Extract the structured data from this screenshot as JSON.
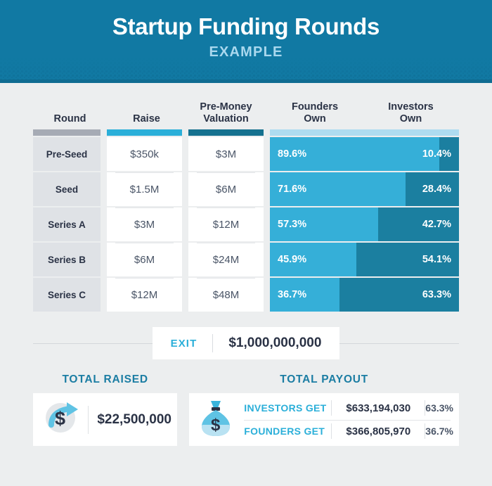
{
  "header": {
    "title": "Startup Funding Rounds",
    "subtitle": "EXAMPLE",
    "bg_color": "#1179A3",
    "title_color": "#FFFFFF",
    "subtitle_color": "#A9D8EE"
  },
  "table": {
    "columns": [
      {
        "key": "round",
        "label": "Round",
        "accent_color": "#A6ABB5"
      },
      {
        "key": "raise",
        "label": "Raise",
        "accent_color": "#2BAFD9"
      },
      {
        "key": "premoney",
        "label": "Pre-Money\nValuation",
        "label_line1": "Pre-Money",
        "label_line2": "Valuation",
        "accent_color": "#15718F"
      },
      {
        "key": "founders",
        "label_line1": "Founders",
        "label_line2": "Own",
        "accent_color": "#AEDCF0"
      },
      {
        "key": "investors",
        "label_line1": "Investors",
        "label_line2": "Own",
        "accent_color": "#AEDCF0"
      }
    ],
    "rows": [
      {
        "round": "Pre-Seed",
        "raise": "$350k",
        "premoney": "$3M",
        "founders_pct": "89.6%",
        "investors_pct": "10.4%",
        "founders_value": 89.6,
        "investors_value": 10.4
      },
      {
        "round": "Seed",
        "raise": "$1.5M",
        "premoney": "$6M",
        "founders_pct": "71.6%",
        "investors_pct": "28.4%",
        "founders_value": 71.6,
        "investors_value": 28.4
      },
      {
        "round": "Series A",
        "raise": "$3M",
        "premoney": "$12M",
        "founders_pct": "57.3%",
        "investors_pct": "42.7%",
        "founders_value": 57.3,
        "investors_value": 42.7
      },
      {
        "round": "Series B",
        "raise": "$6M",
        "premoney": "$24M",
        "founders_pct": "45.9%",
        "investors_pct": "54.1%",
        "founders_value": 45.9,
        "investors_value": 54.1
      },
      {
        "round": "Series C",
        "raise": "$12M",
        "premoney": "$48M",
        "founders_pct": "36.7%",
        "investors_pct": "63.3%",
        "founders_value": 36.7,
        "investors_value": 63.3
      }
    ],
    "founders_bar_color": "#35AFD8",
    "investors_bar_color": "#1B7FA0"
  },
  "exit": {
    "label": "EXIT",
    "value": "$1,000,000,000",
    "label_color": "#2BAFD9"
  },
  "total_raised": {
    "title": "TOTAL RAISED",
    "value": "$22,500,000",
    "icon": "dollar-arrow-up-icon"
  },
  "total_payout": {
    "title": "TOTAL PAYOUT",
    "icon": "money-bag-icon",
    "rows": [
      {
        "label": "INVESTORS GET",
        "amount": "$633,194,030",
        "pct": "63.3%"
      },
      {
        "label": "FOUNDERS GET",
        "amount": "$366,805,970",
        "pct": "36.7%"
      }
    ]
  },
  "chart_data": {
    "type": "bar",
    "title": "Startup Funding Rounds",
    "subtitle": "EXAMPLE",
    "orientation": "horizontal-stacked",
    "categories": [
      "Pre-Seed",
      "Seed",
      "Series A",
      "Series B",
      "Series C"
    ],
    "series": [
      {
        "name": "Founders Own",
        "values": [
          89.6,
          71.6,
          57.3,
          45.9,
          36.7
        ],
        "color": "#35AFD8",
        "unit": "%"
      },
      {
        "name": "Investors Own",
        "values": [
          10.4,
          28.4,
          42.7,
          54.1,
          63.3
        ],
        "color": "#1B7FA0",
        "unit": "%"
      }
    ],
    "table_columns": [
      "Round",
      "Raise",
      "Pre-Money Valuation",
      "Founders Own",
      "Investors Own"
    ],
    "raise": [
      "$350k",
      "$1.5M",
      "$3M",
      "$6M",
      "$12M"
    ],
    "pre_money_valuation": [
      "$3M",
      "$6M",
      "$12M",
      "$24M",
      "$48M"
    ],
    "exit_value": "$1,000,000,000",
    "total_raised": "$22,500,000",
    "total_payout": {
      "investors_get": "$633,194,030",
      "investors_pct": "63.3%",
      "founders_get": "$366,805,970",
      "founders_pct": "36.7%"
    },
    "xlim": [
      0,
      100
    ],
    "grid": false,
    "legend": "column-headers"
  }
}
